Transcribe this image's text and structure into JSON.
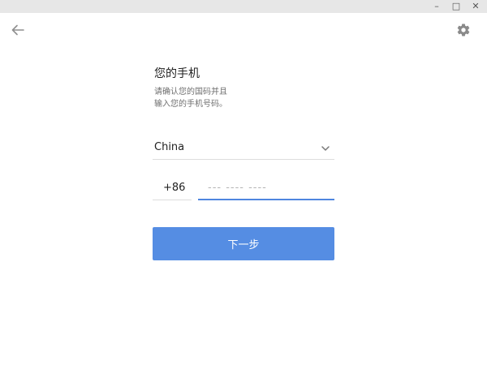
{
  "window": {
    "controls": [
      {
        "name": "minimize-button",
        "glyph": "–"
      },
      {
        "name": "maximize-button",
        "glyph": "□"
      },
      {
        "name": "close-button",
        "glyph": "✕"
      }
    ]
  },
  "nav": {
    "back_icon": "arrow-left-icon",
    "settings_icon": "gear-icon"
  },
  "form": {
    "heading": "您的手机",
    "description_line1": "请确认您的国码并且",
    "description_line2": "输入您的手机号码。",
    "country_label": "China",
    "country_code": "+86",
    "phone_placeholder": "--- ---- ----",
    "phone_value": "",
    "next_label": "下一步"
  },
  "colors": {
    "accent": "#558de3",
    "input_focus": "#4f86df",
    "titlebar": "#e7e7e7"
  }
}
